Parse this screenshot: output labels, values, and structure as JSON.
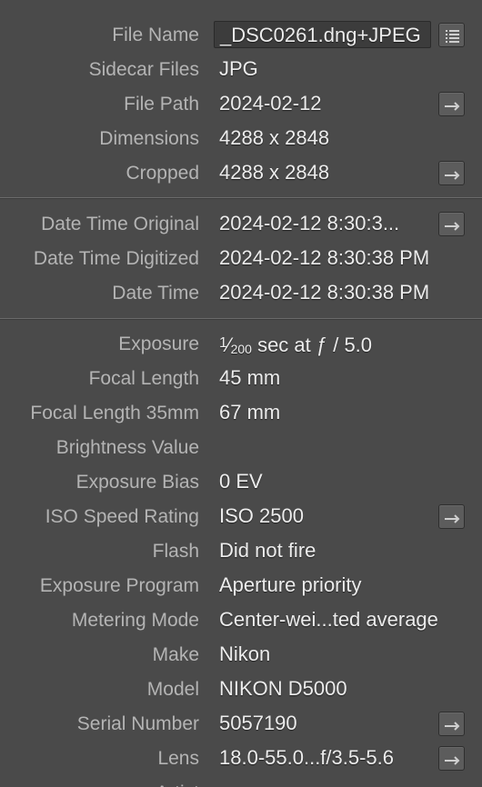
{
  "file": {
    "file_name_label": "File Name",
    "file_name": "_DSC0261.dng+JPEG",
    "sidecar_label": "Sidecar Files",
    "sidecar": "JPG",
    "file_path_label": "File Path",
    "file_path": "2024-02-12",
    "dimensions_label": "Dimensions",
    "dimensions": "4288 x 2848",
    "cropped_label": "Cropped",
    "cropped": "4288 x 2848"
  },
  "dates": {
    "original_label": "Date Time Original",
    "original": "2024-02-12 8:30:3...",
    "digitized_label": "Date Time Digitized",
    "digitized": "2024-02-12 8:30:38 PM",
    "datetime_label": "Date Time",
    "datetime": "2024-02-12 8:30:38 PM"
  },
  "exif": {
    "exposure_label": "Exposure",
    "exposure_num": "1",
    "exposure_den": "200",
    "exposure_rest": " sec at ƒ / 5.0",
    "focal_label": "Focal Length",
    "focal": "45 mm",
    "focal35_label": "Focal Length 35mm",
    "focal35": "67 mm",
    "brightness_label": "Brightness Value",
    "brightness": "",
    "bias_label": "Exposure Bias",
    "bias": "0 EV",
    "iso_label": "ISO Speed Rating",
    "iso": "ISO 2500",
    "flash_label": "Flash",
    "flash": "Did not fire",
    "program_label": "Exposure Program",
    "program": "Aperture priority",
    "metering_label": "Metering Mode",
    "metering": "Center-wei...ted average",
    "make_label": "Make",
    "make": "Nikon",
    "model_label": "Model",
    "model": "NIKON D5000",
    "serial_label": "Serial Number",
    "serial": "5057190",
    "lens_label": "Lens",
    "lens": "18.0-55.0...f/3.5-5.6",
    "next_label": "Artist"
  },
  "icons": {
    "list": "list-icon",
    "goto": "arrow-right-icon"
  },
  "colors": {
    "background": "#4a4a4a",
    "label": "#b4b4b4",
    "value": "#ececec"
  }
}
